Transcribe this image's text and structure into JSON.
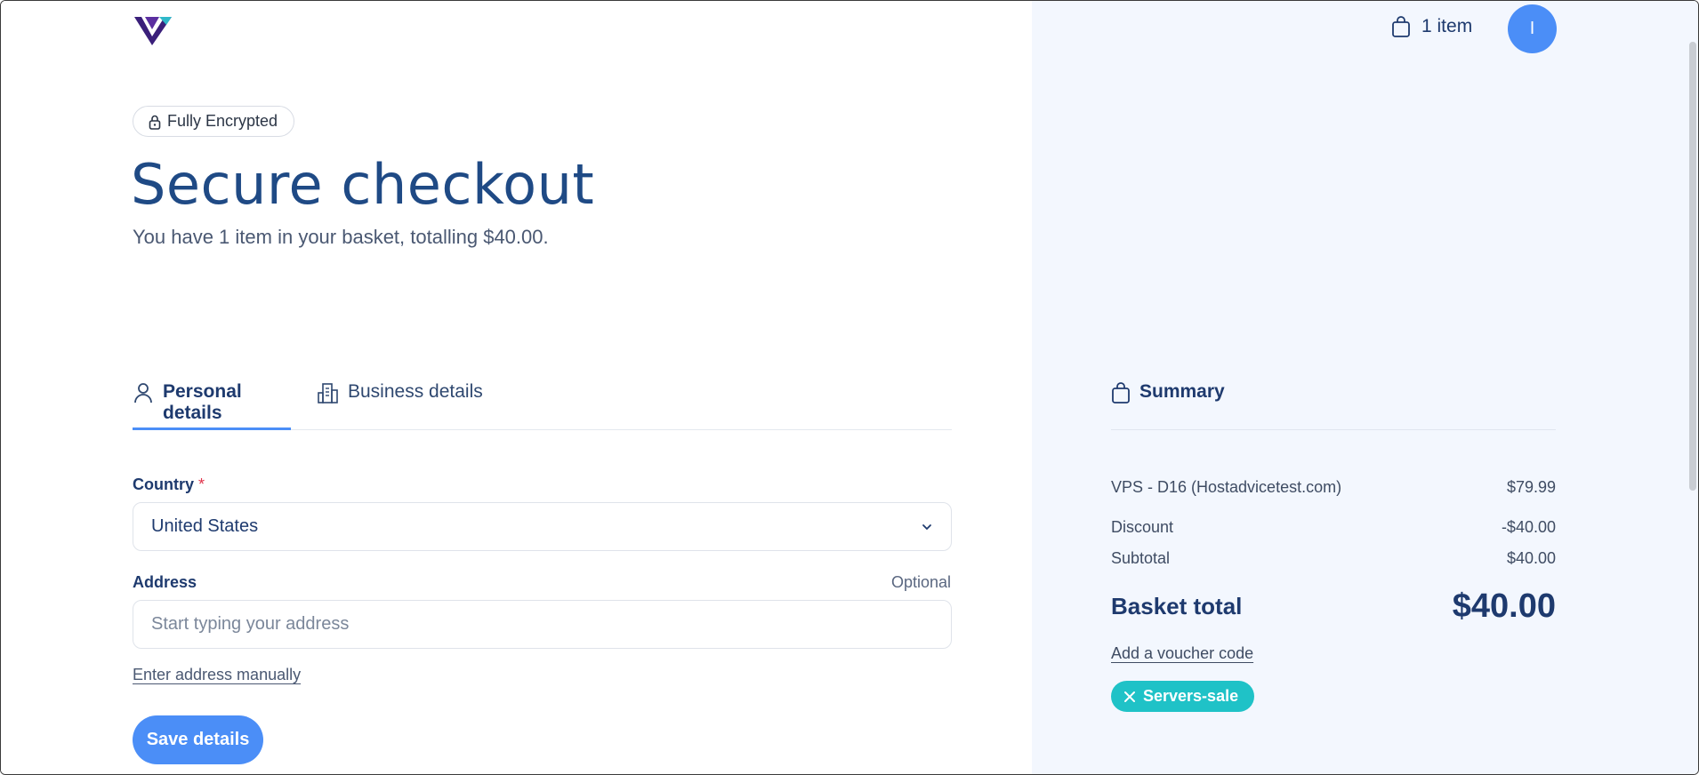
{
  "header": {
    "cart_label": "1 item",
    "avatar_initial": "I"
  },
  "hero": {
    "badge": "Fully Encrypted",
    "title": "Secure checkout",
    "subtitle": "You have 1 item in your basket, totalling $40.00."
  },
  "tabs": [
    {
      "label": "Personal details",
      "icon": "user-icon",
      "active": true
    },
    {
      "label": "Business details",
      "icon": "building-icon",
      "active": false
    }
  ],
  "form": {
    "country_label": "Country",
    "country_required": "*",
    "country_value": "United States",
    "address_label": "Address",
    "address_optional": "Optional",
    "address_placeholder": "Start typing your address",
    "manual_link": "Enter address manually",
    "save_label": "Save details"
  },
  "summary": {
    "heading": "Summary",
    "item_name": "VPS - D16 (Hostadvicetest.com)",
    "item_price": "$79.99",
    "discount_label": "Discount",
    "discount_value": "-$40.00",
    "subtotal_label": "Subtotal",
    "subtotal_value": "$40.00",
    "total_label": "Basket total",
    "total_value": "$40.00",
    "voucher_link": "Add a voucher code",
    "voucher_code": "Servers-sale"
  },
  "colors": {
    "accent": "#4b8ef7",
    "heading": "#1f4a85",
    "panel_bg": "#f3f7fe",
    "voucher_pill": "#1fc2c7",
    "required": "#e0344b"
  }
}
